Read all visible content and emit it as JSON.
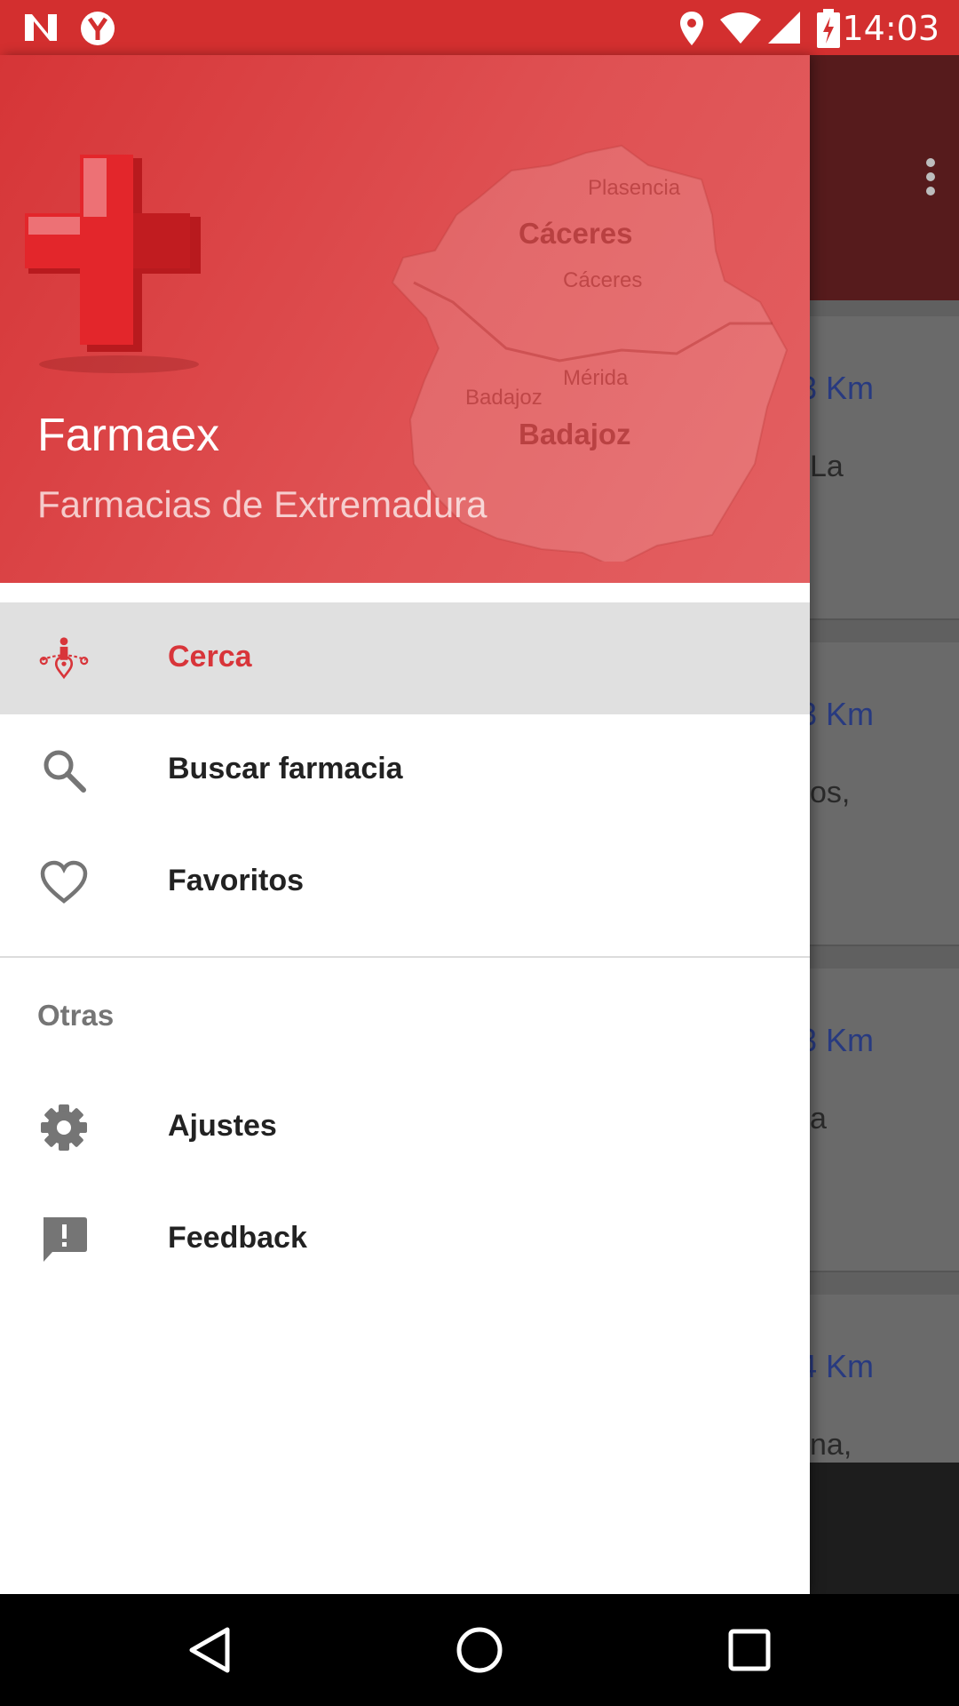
{
  "status_bar": {
    "time": "14:03"
  },
  "drawer": {
    "header": {
      "title": "Farmaex",
      "subtitle": "Farmacias de Extremadura",
      "map_labels": {
        "plasencia": "Plasencia",
        "caceres_region": "Cáceres",
        "caceres_city": "Cáceres",
        "merida": "Mérida",
        "badajoz_city": "Badajoz",
        "badajoz_region": "Badajoz"
      }
    },
    "menu": {
      "cerca": "Cerca",
      "buscar": "Buscar farmacia",
      "favoritos": "Favoritos"
    },
    "section_title": "Otras",
    "other": {
      "ajustes": "Ajustes",
      "feedback": "Feedback"
    }
  },
  "background": {
    "cards": [
      {
        "distance": "3 Km",
        "address": "La"
      },
      {
        "distance": "3 Km",
        "address": "os,"
      },
      {
        "distance": "3 Km",
        "address": "a"
      },
      {
        "distance": "4 Km",
        "address": "na,"
      }
    ]
  },
  "colors": {
    "accent": "#d8353a",
    "status_bar": "#d32f2f",
    "toolbar": "#561b1c"
  }
}
